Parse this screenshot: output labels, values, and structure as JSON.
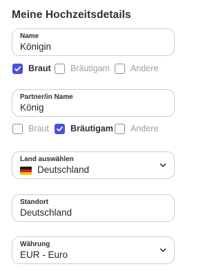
{
  "page_title": "Meine Hochzeitsdetails",
  "name_field": {
    "label": "Name",
    "value": "Königin"
  },
  "role_group_1": {
    "options": [
      {
        "label": "Braut",
        "checked": true
      },
      {
        "label": "Bräutigam",
        "checked": false
      },
      {
        "label": "Andere",
        "checked": false
      }
    ]
  },
  "partner_field": {
    "label": "Partner/in Name",
    "value": "König"
  },
  "role_group_2": {
    "options": [
      {
        "label": "Braut",
        "checked": false
      },
      {
        "label": "Bräutigam",
        "checked": true
      },
      {
        "label": "Andere",
        "checked": false
      }
    ]
  },
  "country_select": {
    "label": "Land auswählen",
    "value": "Deutschland",
    "flag_icon": "germany-flag-icon"
  },
  "location_field": {
    "label": "Standort",
    "value": "Deutschland"
  },
  "currency_select": {
    "label": "Währung",
    "value": "EUR - Euro"
  },
  "colors": {
    "accent": "#4b4fe0",
    "border": "#c9ccd4",
    "muted_text": "#9a9ea8"
  }
}
